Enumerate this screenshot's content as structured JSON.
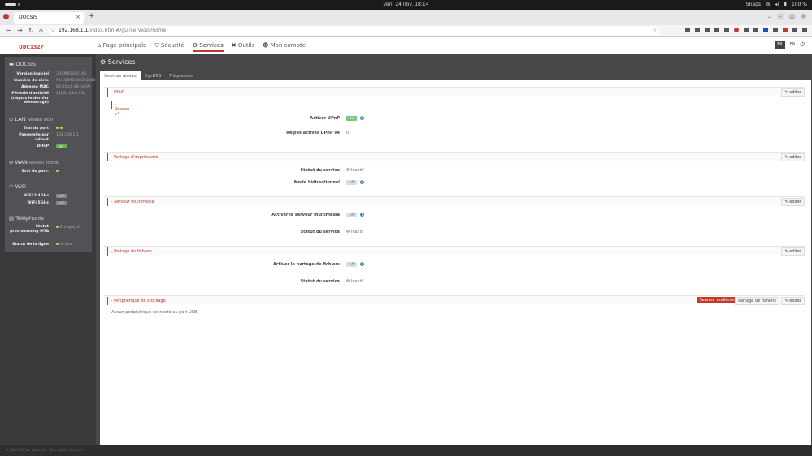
{
  "os": {
    "clock": "ven. 24 nov.  18:14",
    "snaps": "Snaps",
    "battery": "100 %"
  },
  "browser": {
    "tab_title": "DOCSIS",
    "url_host": "192.168.1.1",
    "url_path": "/index.html#/gui/services/home",
    "newtab": "+",
    "close": "×"
  },
  "app": {
    "logo": "UBC1327",
    "nav": [
      "Page principale",
      "Sécurité",
      "Services",
      "Outils",
      "Mon compte"
    ],
    "lang_fr": "FR",
    "lang_en": "EN"
  },
  "sidebar": {
    "docsis": {
      "title": "DOCSIS",
      "labels": [
        "Version logiciel",
        "Numéro de série",
        "Adresse MAC",
        "Période d'activité (depuis le dernier démarrage)"
      ],
      "values": [
        "3DCM01180145...",
        "MU1B0984403534004",
        "80:35:c6:e8:ce:69",
        "24j 8h 23m 25s"
      ]
    },
    "lan": {
      "title": "LAN",
      "sub": "Réseau local",
      "labels": [
        "Etat du port",
        "Passerelle par défaut",
        "DHCP"
      ],
      "gateway": "192.168.1.1",
      "dhcp": "on"
    },
    "wan": {
      "title": "WAN",
      "sub": "Réseau étendu",
      "label": "Etat du port:"
    },
    "wifi": {
      "title": "WiFi",
      "labels": [
        "WiFi 2.4GHz",
        "WiFi 5GHz"
      ],
      "values": [
        "off",
        "off"
      ]
    },
    "tel": {
      "title": "Téléphonie",
      "labels": [
        "Statut provisionning MTA",
        "Statut de la ligne"
      ],
      "values": [
        "Enregistré",
        "Active"
      ]
    }
  },
  "page": {
    "title": "Services",
    "subtabs": [
      "Services réseau",
      "DynDNS",
      "Fréquences"
    ],
    "edit": "editer",
    "upnp": {
      "title": "UPnP",
      "sub": "Réseau v4",
      "label1": "Activer UPnP",
      "toggle": "on",
      "label2": "Règles actives UPnP v4",
      "value2": "0"
    },
    "printer": {
      "title": "Partage d'imprimante",
      "label1": "Statut du service",
      "value1": "Inactif",
      "label2": "Mode bidirectionnel",
      "toggle": "off"
    },
    "media": {
      "title": "Serveur multimédia",
      "label1": "Activer le serveur multimédia",
      "toggle": "off",
      "label2": "Statut du service",
      "value2": "Inactif"
    },
    "files": {
      "title": "Partage de fichiers",
      "label1": "Activer le partage de fichiers",
      "toggle": "off",
      "label2": "Statut du service",
      "value2": "Inactif"
    },
    "storage": {
      "title": "Périphérique de stockage",
      "btn1": "Serveur multimédia",
      "btn2": "Partage de fichiers",
      "note": "Aucun périphérique connecté au port USB."
    }
  },
  "footer": "© 2016 Wilde Labs, Ilv - Neu Welle Meinen"
}
